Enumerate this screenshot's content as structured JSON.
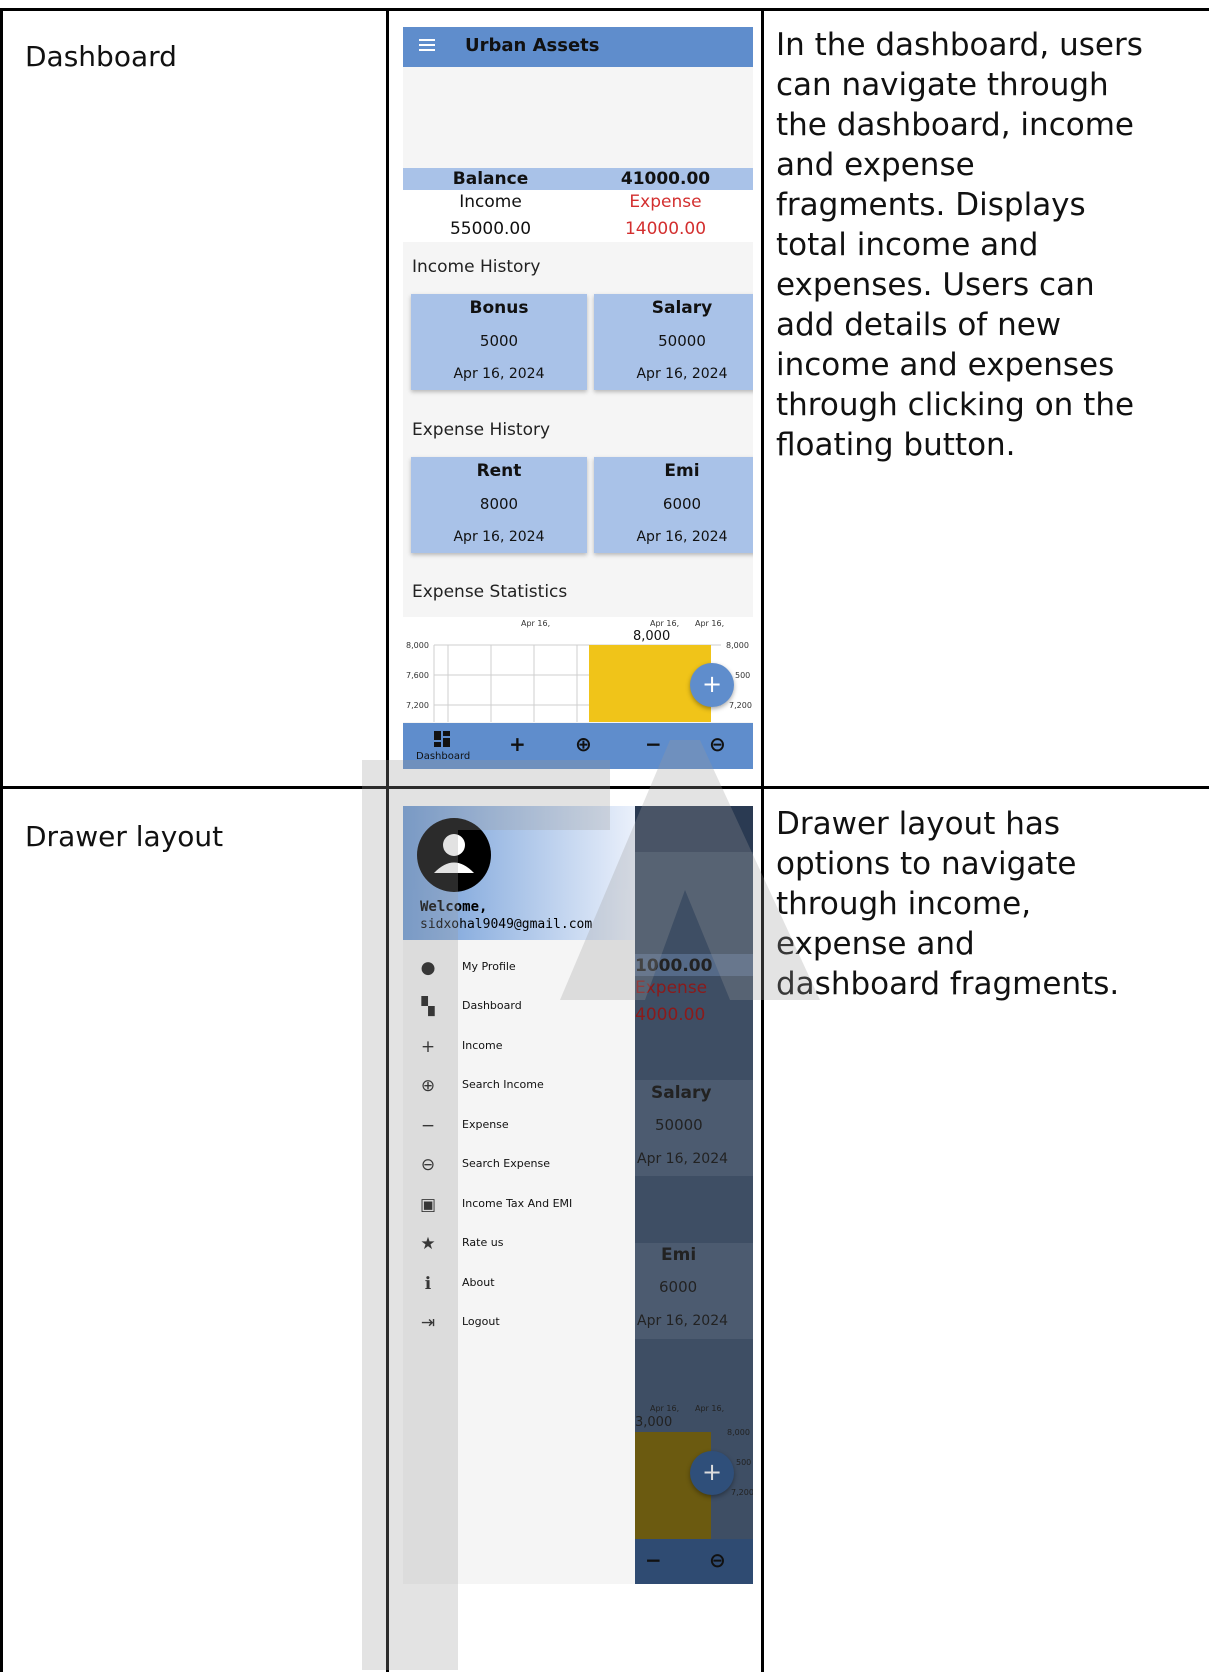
{
  "rows": [
    {
      "label": "Dashboard",
      "description": [
        "In the dashboard, users",
        "can navigate through",
        "the dashboard, income",
        "and expense",
        "fragments. Displays",
        "total income and",
        "expenses. Users can",
        "add details of new",
        "income and expenses",
        "through clicking on the",
        "floating button."
      ]
    },
    {
      "label": "Drawer layout",
      "description": [
        "Drawer layout has",
        "options to navigate",
        "through income,",
        "expense and",
        "dashboard fragments."
      ]
    }
  ],
  "app": {
    "title": "Urban Assets",
    "balance_label": "Balance",
    "balance_value": "41000.00",
    "income_label": "Income",
    "expense_label": "Expense",
    "income_value": "55000.00",
    "expense_value": "14000.00",
    "income_history_title": "Income History",
    "expense_history_title": "Expense History",
    "expense_stats_title": "Expense Statistics",
    "income_cards": [
      {
        "title": "Bonus",
        "amount": "5000",
        "date": "Apr 16, 2024"
      },
      {
        "title": "Salary",
        "amount": "50000",
        "date": "Apr 16, 2024"
      }
    ],
    "expense_cards": [
      {
        "title": "Rent",
        "amount": "8000",
        "date": "Apr 16, 2024"
      },
      {
        "title": "Emi",
        "amount": "6000",
        "date": "Apr 16, 2024"
      }
    ],
    "chart": {
      "top_labels": [
        "Apr 16,",
        "Apr 16,",
        "Apr 16,"
      ],
      "bar_value_label": "8,000",
      "y_left": [
        "8,000",
        "7,600",
        "7,200"
      ],
      "y_right": [
        "8,000",
        "500",
        "7,200"
      ]
    },
    "fab_label": "+",
    "bottom_nav": {
      "dashboard_label": "Dashboard",
      "icons": [
        "dashboard-icon",
        "add-icon",
        "zoom-in-icon",
        "minus-icon",
        "zoom-out-icon"
      ]
    },
    "colors": {
      "primary": "#5f8dcc",
      "card": "#a9c2e8",
      "bar": "#f0c419",
      "expense_red": "#d32f2f"
    }
  },
  "drawer": {
    "welcome": "Welcome,",
    "email": "sidxohal9049@gmail.com",
    "items": [
      {
        "icon": "account-circle-icon",
        "glyph": "●",
        "label": "My Profile"
      },
      {
        "icon": "dashboard-icon",
        "glyph": "▚",
        "label": "Dashboard"
      },
      {
        "icon": "add-icon",
        "glyph": "+",
        "label": "Income"
      },
      {
        "icon": "zoom-in-icon",
        "glyph": "⊕",
        "label": "Search Income"
      },
      {
        "icon": "minus-icon",
        "glyph": "−",
        "label": "Expense"
      },
      {
        "icon": "zoom-out-icon",
        "glyph": "⊖",
        "label": "Search Expense"
      },
      {
        "icon": "wallet-icon",
        "glyph": "▣",
        "label": "Income Tax And EMI"
      },
      {
        "icon": "star-icon",
        "glyph": "★",
        "label": "Rate us"
      },
      {
        "icon": "info-icon",
        "glyph": "ℹ",
        "label": "About"
      },
      {
        "icon": "logout-icon",
        "glyph": "⇥",
        "label": "Logout"
      }
    ],
    "behind": {
      "balance_value": "1000.00",
      "expense_label": "Expense",
      "expense_value": "4000.00",
      "salary": "Salary",
      "salary_amount": "50000",
      "salary_date": "Apr 16, 2024",
      "emi": "Emi",
      "emi_amount": "6000",
      "emi_date": "Apr 16, 2024",
      "chart_top": [
        "Apr 16,",
        "Apr 16,"
      ],
      "bar_value_label": "3,000",
      "y_right": [
        "8,000",
        "500",
        "7,200"
      ],
      "fab_label": "+"
    }
  }
}
